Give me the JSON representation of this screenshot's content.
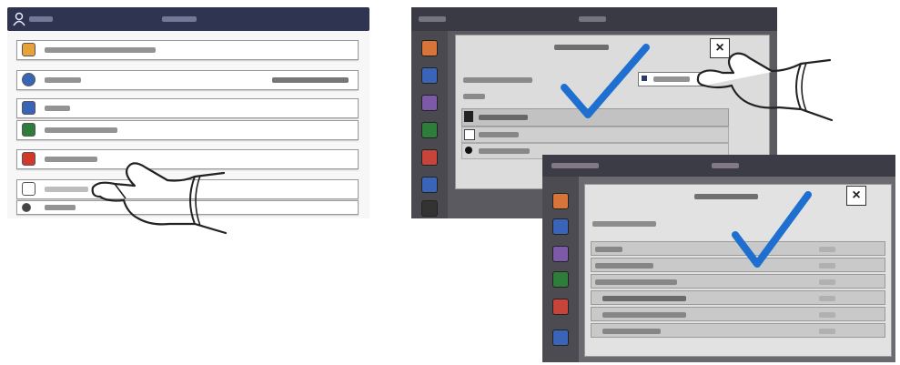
{
  "panel1": {
    "rows": [
      {
        "icon": "document-icon",
        "icon_color": "#e8a23a"
      },
      {
        "icon": "globe-icon",
        "icon_color": "#3a64b8"
      },
      {
        "icon": "badge-icon",
        "icon_color": "#3a64b8"
      },
      {
        "icon": "contact-icon",
        "icon_color": "#2e7d3a"
      },
      {
        "icon": "printer-icon",
        "icon_color": "#d2392b"
      },
      {
        "icon": "server-icon",
        "icon_color": "#7d5aa8"
      },
      {
        "icon": "gear-icon",
        "icon_color": "#555555"
      }
    ]
  },
  "panel2": {
    "sidebar_icons": [
      "app-icon-orange",
      "app-icon-blue",
      "app-icon-purple",
      "app-icon-green",
      "app-icon-red",
      "app-icon-blue",
      "app-icon-dark"
    ],
    "dialog": {
      "close_label": "×"
    }
  },
  "panel3": {
    "dialog": {
      "close_label": "×"
    }
  },
  "colors": {
    "check": "#1e6fd0",
    "header": "#2f3450",
    "dialog_bg": "#dcdcdc"
  }
}
